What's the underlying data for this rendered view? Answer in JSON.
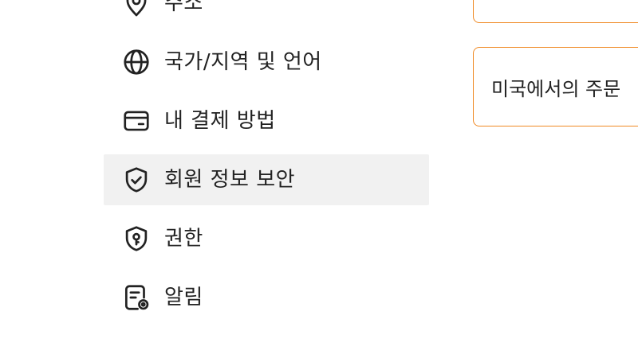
{
  "menu": {
    "items": [
      {
        "label": "주소",
        "icon": "location-pin-icon"
      },
      {
        "label": "국가/지역 및 언어",
        "icon": "globe-icon"
      },
      {
        "label": "내 결제 방법",
        "icon": "credit-card-icon"
      },
      {
        "label": "회원 정보 보안",
        "icon": "shield-check-icon",
        "active": true
      },
      {
        "label": "권한",
        "icon": "shield-key-icon"
      },
      {
        "label": "알림",
        "icon": "notification-settings-icon"
      }
    ]
  },
  "cards": {
    "second": {
      "text": "미국에서의 주문"
    }
  },
  "colors": {
    "accent": "#f08a24",
    "active_bg": "#f1f1f1",
    "text": "#222222"
  }
}
